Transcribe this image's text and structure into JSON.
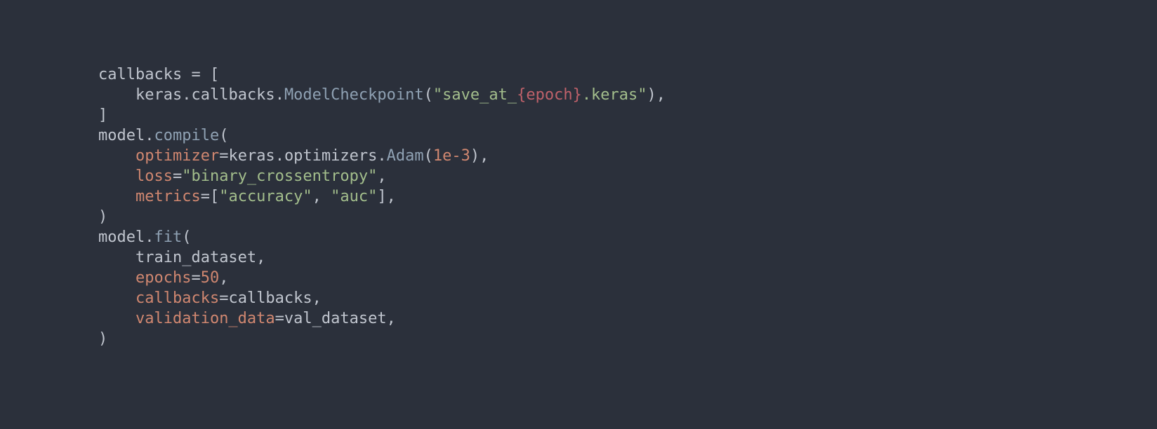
{
  "code": {
    "line1": {
      "callbacks_var": "callbacks",
      "eq": " = ",
      "lbracket": "["
    },
    "line2": {
      "indent": "    ",
      "keras": "keras",
      "dot1": ".",
      "callbacks_mod": "callbacks",
      "dot2": ".",
      "ModelCheckpoint": "ModelCheckpoint",
      "lparen": "(",
      "str_open": "\"save_at_",
      "interp": "{epoch}",
      "str_close": ".keras\"",
      "rparen_comma": "),"
    },
    "line3": {
      "rbracket": "]"
    },
    "line4": {
      "model": "model",
      "dot": ".",
      "compile": "compile",
      "lparen": "("
    },
    "line5": {
      "indent": "    ",
      "optimizer_kw": "optimizer",
      "eq": "=",
      "keras": "keras",
      "dot1": ".",
      "optimizers": "optimizers",
      "dot2": ".",
      "Adam": "Adam",
      "lparen": "(",
      "num": "1e-3",
      "rparen_comma": "),"
    },
    "line6": {
      "indent": "    ",
      "loss_kw": "loss",
      "eq": "=",
      "str": "\"binary_crossentropy\"",
      "comma": ","
    },
    "line7": {
      "indent": "    ",
      "metrics_kw": "metrics",
      "eq": "=",
      "lbracket": "[",
      "str1": "\"accuracy\"",
      "comma1": ", ",
      "str2": "\"auc\"",
      "rbracket_comma": "],"
    },
    "line8": {
      "rparen": ")"
    },
    "line9": {
      "model": "model",
      "dot": ".",
      "fit": "fit",
      "lparen": "("
    },
    "line10": {
      "indent": "    ",
      "arg": "train_dataset",
      "comma": ","
    },
    "line11": {
      "indent": "    ",
      "epochs_kw": "epochs",
      "eq": "=",
      "num": "50",
      "comma": ","
    },
    "line12": {
      "indent": "    ",
      "callbacks_kw": "callbacks",
      "eq": "=",
      "val": "callbacks",
      "comma": ","
    },
    "line13": {
      "indent": "    ",
      "validation_data_kw": "validation_data",
      "eq": "=",
      "val": "val_dataset",
      "comma": ","
    },
    "line14": {
      "rparen": ")"
    }
  }
}
